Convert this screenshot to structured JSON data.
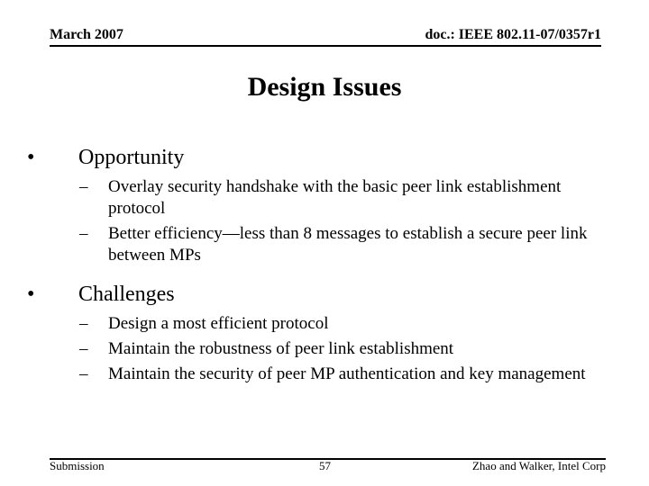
{
  "header": {
    "date": "March 2007",
    "doc_id": "doc.: IEEE 802.11-07/0357r1"
  },
  "title": "Design Issues",
  "sections": [
    {
      "heading": "Opportunity",
      "bullet_icon": "•",
      "items": [
        "Overlay security handshake with the basic peer link establishment protocol",
        "Better efficiency—less than 8 messages to establish a secure peer link between MPs"
      ]
    },
    {
      "heading": "Challenges",
      "bullet_icon": "•",
      "items": [
        "Design a most efficient protocol",
        "Maintain the robustness of peer link establishment",
        "Maintain the security of peer MP authentication and key management"
      ]
    }
  ],
  "sub_bullet_icon": "–",
  "footer": {
    "left": "Submission",
    "page": "57",
    "right": "Zhao and Walker, Intel Corp"
  }
}
